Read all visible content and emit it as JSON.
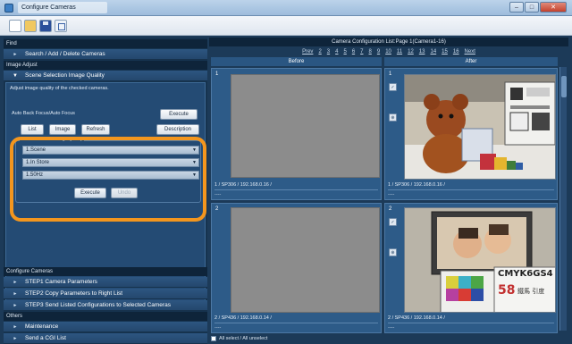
{
  "window": {
    "title": "Configure Cameras"
  },
  "toolbar": {
    "icons": [
      "new-icon",
      "open-icon",
      "save-icon",
      "properties-icon"
    ]
  },
  "left": {
    "find_header": "Find",
    "search_item": "Search / Add / Delete Cameras",
    "image_adjust_header": "Image Adjust",
    "scene_item": "Scene Selection Image Quality",
    "description": "Adjust image quality of the checked cameras.",
    "af_label": "Auto Back Focus/Auto Focus",
    "execute_label": "Execute",
    "list_label": "List",
    "image_label": "Image",
    "refresh_label": "Refresh",
    "description_button": "Description",
    "group_title": "Scene Selection Image Quality",
    "selects": [
      "1.Scene",
      "1.In Store",
      "1.50Hz"
    ],
    "group_execute": "Execute",
    "undo_label": "Undo",
    "configure_header": "Configure Cameras",
    "step1": "STEP1 Camera Parameters",
    "step2": "STEP2 Copy Parameters to Right List",
    "step3": "STEP3 Send Listed Configurations to Selected Cameras",
    "others_header": "Others",
    "maintenance": "Maintenance",
    "send_cgi": "Send a CGI List"
  },
  "right": {
    "header": "Camera Configuration List:Page 1(Camera1-16)",
    "prev": "Prev",
    "pages": [
      "2",
      "3",
      "4",
      "5",
      "6",
      "7",
      "8",
      "9",
      "10",
      "11",
      "12",
      "13",
      "14",
      "15",
      "16"
    ],
    "next": "Next",
    "before": "Before",
    "after": "After",
    "cells": [
      {
        "num": "1",
        "addr": "1 / SP306 / 192.168.0.16 /",
        "dash": "----"
      },
      {
        "num": "1",
        "addr": "1 / SP306 / 192.168.0.16 /",
        "dash": "----"
      },
      {
        "num": "2",
        "addr": "2 / SP436 / 192.168.0.14 /",
        "dash": "----"
      },
      {
        "num": "2",
        "addr": "2 / SP436 / 192.168.0.14 /",
        "dash": "----"
      }
    ],
    "photo_text": "CMYK6GS4",
    "photo_text2": "58",
    "photo_text3": "鐵馬 引度",
    "select_all": "All select / All unselect"
  }
}
